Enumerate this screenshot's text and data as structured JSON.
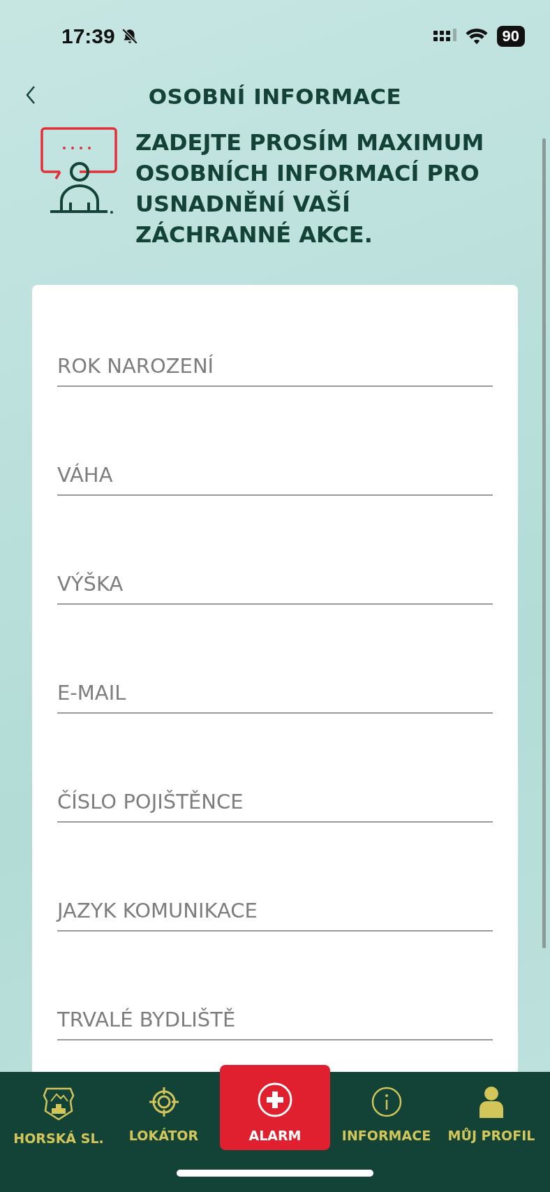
{
  "status_bar": {
    "time": "17:39",
    "battery": "90"
  },
  "header": {
    "title": "OSOBNÍ INFORMACE"
  },
  "intro": {
    "text": "ZADEJTE PROSÍM MAXIMUM OSOBNÍCH INFORMACÍ PRO USNADNĚNÍ VAŠÍ ZÁCHRANNÉ AKCE."
  },
  "form": {
    "fields": [
      {
        "placeholder": "ROK NAROZENÍ"
      },
      {
        "placeholder": "VÁHA"
      },
      {
        "placeholder": "VÝŠKA"
      },
      {
        "placeholder": "E-MAIL"
      },
      {
        "placeholder": "ČÍSLO POJIŠTĚNCE"
      },
      {
        "placeholder": "JAZYK KOMUNIKACE"
      },
      {
        "placeholder": "TRVALÉ BYDLIŠTĚ"
      }
    ]
  },
  "tab_bar": {
    "items": [
      {
        "label": "HORSKÁ SL.",
        "kind": "emblem"
      },
      {
        "label": "LOKÁTOR",
        "kind": "target"
      },
      {
        "label": "ALARM",
        "kind": "alarm"
      },
      {
        "label": "INFORMACE",
        "kind": "info"
      },
      {
        "label": "MŮJ PROFIL",
        "kind": "person"
      }
    ]
  }
}
